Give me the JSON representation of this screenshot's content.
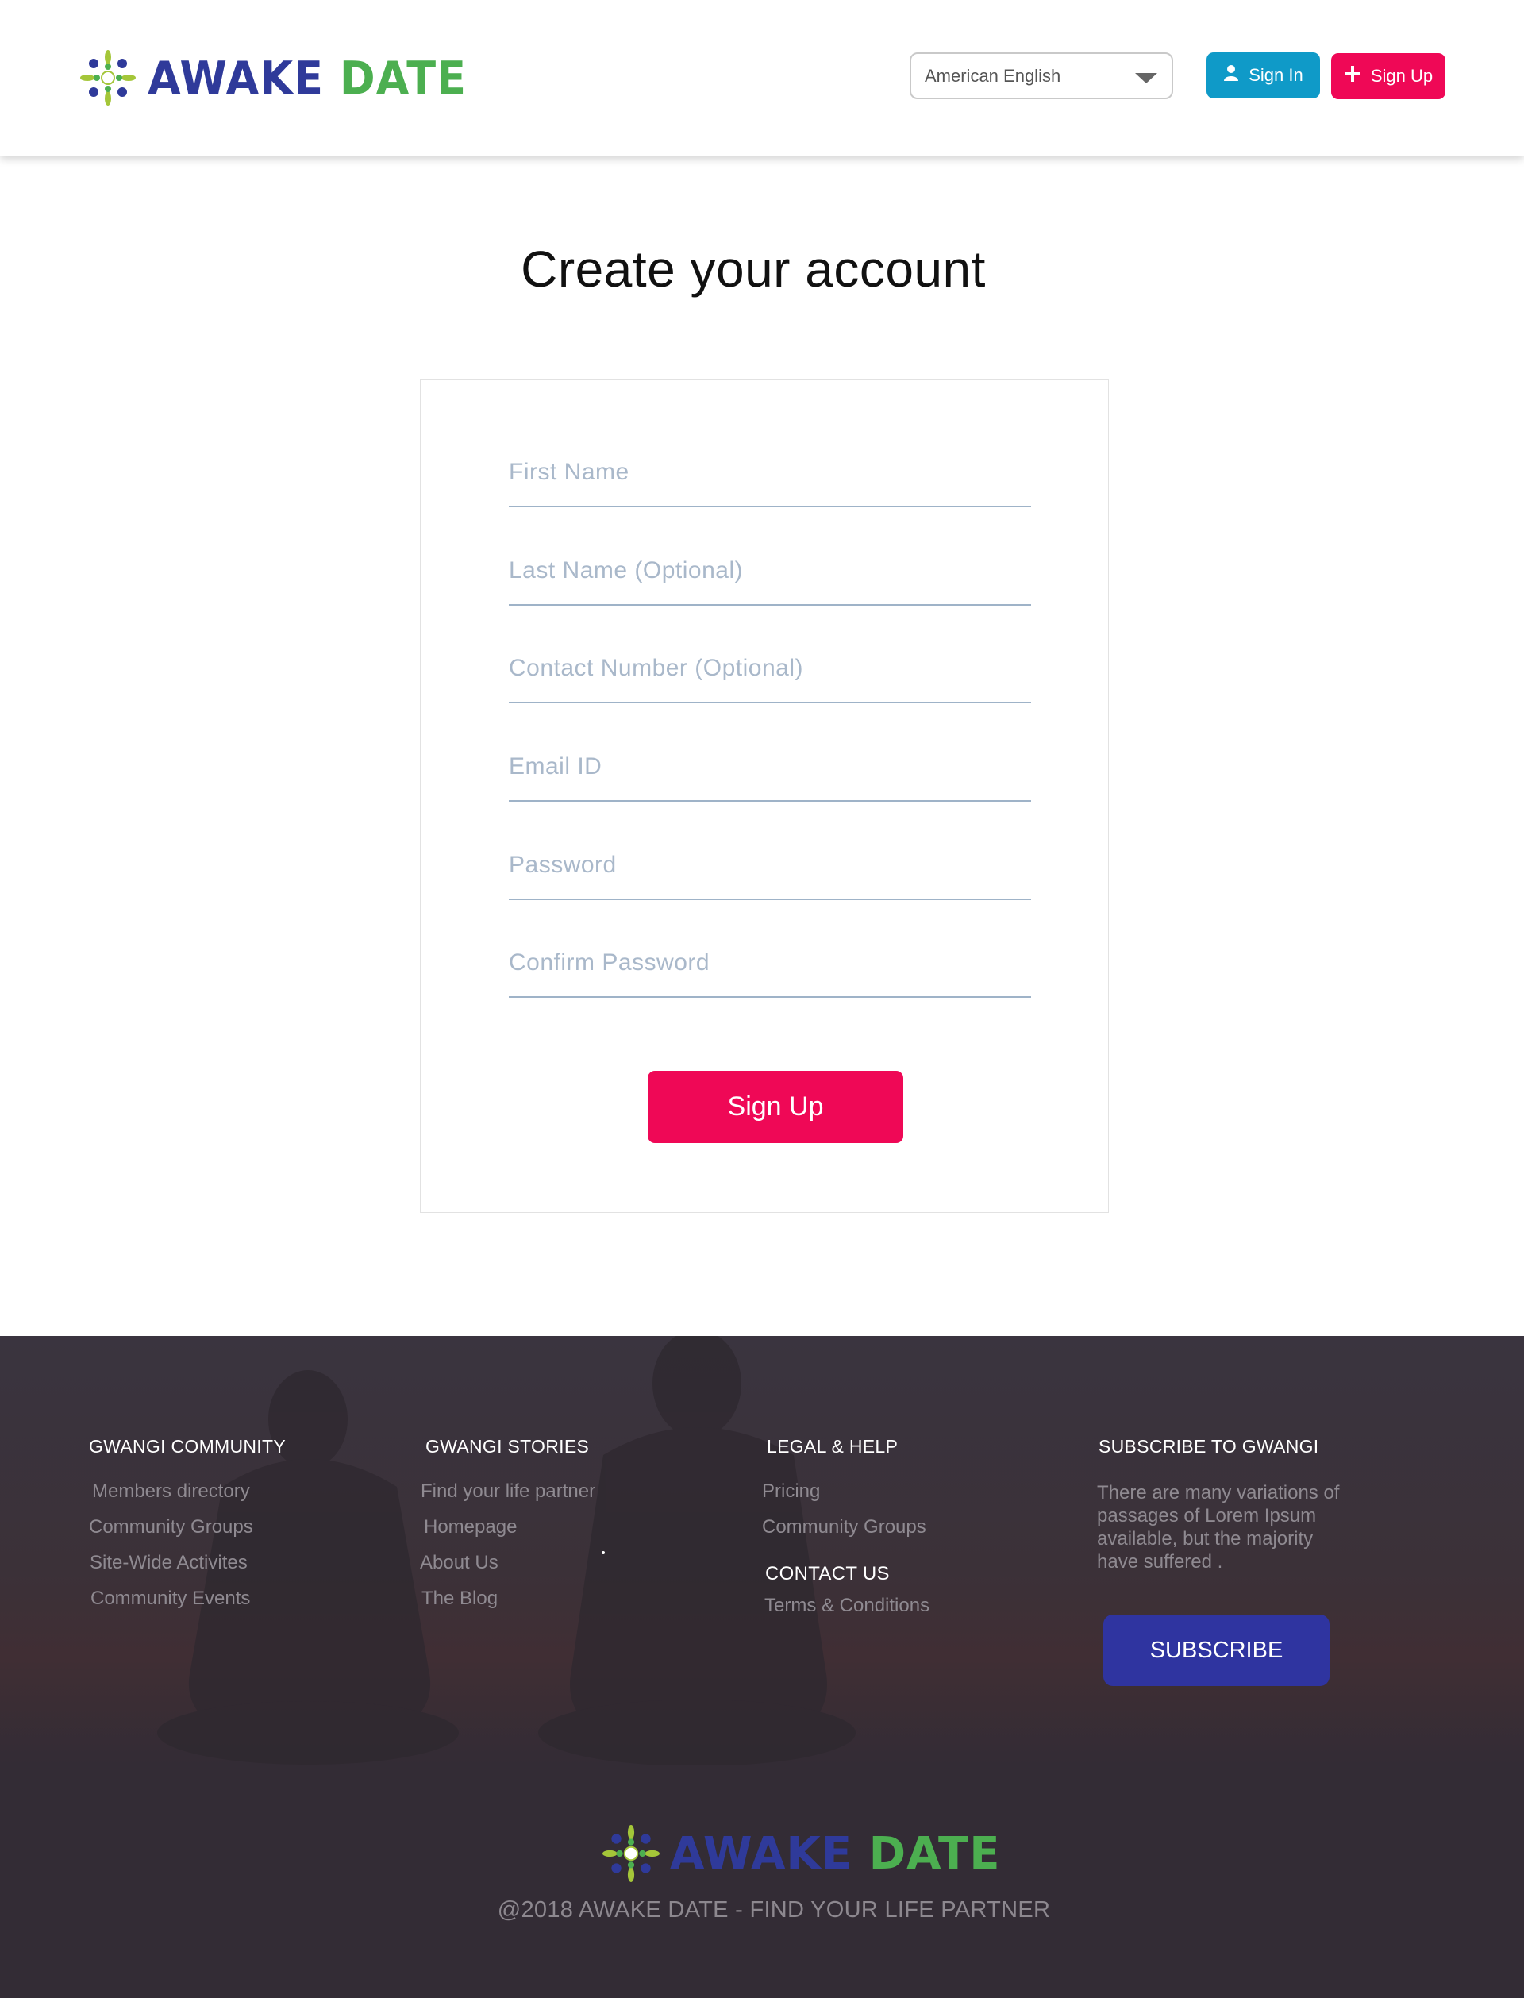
{
  "brand": {
    "name_part1": "AWAKE",
    "name_part2": "DATE",
    "colors": {
      "blue": "#2f3a9a",
      "green": "#4caf50",
      "lime": "#a4c639"
    }
  },
  "header": {
    "language": {
      "selected": "American English",
      "icon": "chevron-down-icon"
    },
    "signin": {
      "label": "Sign In",
      "icon": "user-icon",
      "color": "#0f9ac8"
    },
    "signup": {
      "label": "Sign Up",
      "icon": "plus-icon",
      "color": "#ef0856"
    }
  },
  "main": {
    "title": "Create your account",
    "fields": [
      {
        "placeholder": "First Name",
        "value": ""
      },
      {
        "placeholder": "Last Name (Optional)",
        "value": ""
      },
      {
        "placeholder": "Contact Number (Optional)",
        "value": ""
      },
      {
        "placeholder": "Email ID",
        "value": ""
      },
      {
        "placeholder": "Password",
        "value": ""
      },
      {
        "placeholder": "Confirm Password",
        "value": ""
      }
    ],
    "submit_label": "Sign Up"
  },
  "footer": {
    "community": {
      "heading": "GWANGI COMMUNITY",
      "links": [
        "Members directory",
        "Community Groups",
        "Site-Wide Activites",
        "Community Events"
      ]
    },
    "stories": {
      "heading": "GWANGI STORIES",
      "links": [
        "Find your life partner",
        "Homepage",
        "About Us",
        "The Blog"
      ]
    },
    "legal": {
      "heading": "LEGAL & HELP",
      "links": [
        "Pricing",
        "Community Groups"
      ],
      "contact_heading": "CONTACT US",
      "contact_links": [
        "Terms & Conditions"
      ]
    },
    "subscribe": {
      "heading": "SUBSCRIBE TO GWANGI",
      "text": "There are many variations of passages of Lorem Ipsum available, but the majority have suffered .",
      "button_label": "SUBSCRIBE",
      "button_color": "#2f34a0"
    },
    "copyright": "@2018 AWAKE DATE - FIND YOUR LIFE PARTNER"
  }
}
